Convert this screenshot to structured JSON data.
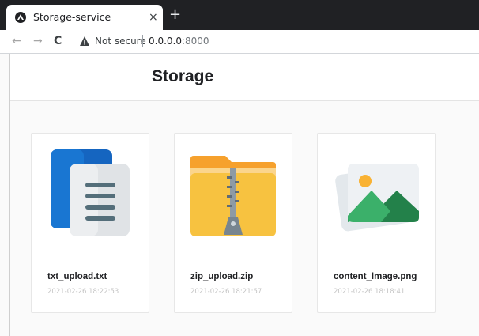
{
  "browser": {
    "tab_title": "Storage-service",
    "tab_close": "×",
    "new_tab": "+",
    "back": "←",
    "forward": "→",
    "reload": "C",
    "security_label": "Not secure",
    "url_host": "0.0.0.0",
    "url_port": ":8000"
  },
  "page": {
    "title": "Storage"
  },
  "files": [
    {
      "name": "txt_upload.txt",
      "date": "2021-02-26 18:22:53",
      "icon": "text-document-icon"
    },
    {
      "name": "zip_upload.zip",
      "date": "2021-02-26 18:21:57",
      "icon": "zip-folder-icon"
    },
    {
      "name": "content_Image.png",
      "date": "2021-02-26 18:18:41",
      "icon": "image-file-icon"
    }
  ],
  "colors": {
    "doc_blue": "#1565c0",
    "doc_gray": "#e0e3e6",
    "folder_orange": "#f6a12d",
    "folder_yellow": "#f7c240",
    "image_green": "#2f9e5e",
    "image_sun": "#f9b233"
  }
}
